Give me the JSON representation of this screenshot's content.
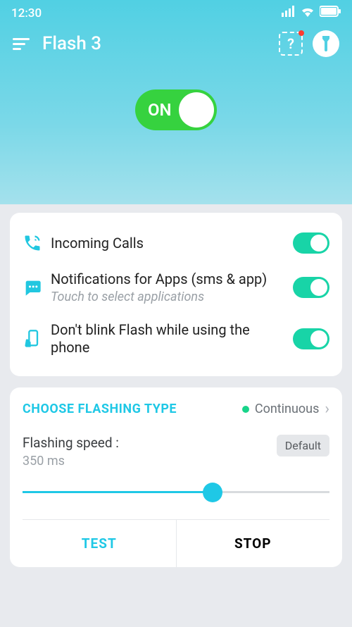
{
  "statusBar": {
    "time": "12:30"
  },
  "appBar": {
    "title": "Flash 3",
    "helpSymbol": "?"
  },
  "mainToggle": {
    "label": "ON",
    "on": true
  },
  "options": [
    {
      "icon": "phone",
      "title": "Incoming Calls",
      "subtitle": "",
      "on": true
    },
    {
      "icon": "chat",
      "title": "Notifications for Apps (sms & app)",
      "subtitle": "Touch to select applications",
      "on": true
    },
    {
      "icon": "phone-hand",
      "title": "Don't blink Flash while using the phone",
      "subtitle": "",
      "on": true
    }
  ],
  "flashingType": {
    "label": "CHOOSE FLASHING TYPE",
    "value": "Continuous"
  },
  "speed": {
    "label": "Flashing speed :",
    "value": "350 ms",
    "defaultLabel": "Default",
    "percent": 62
  },
  "buttons": {
    "test": "TEST",
    "stop": "STOP"
  }
}
